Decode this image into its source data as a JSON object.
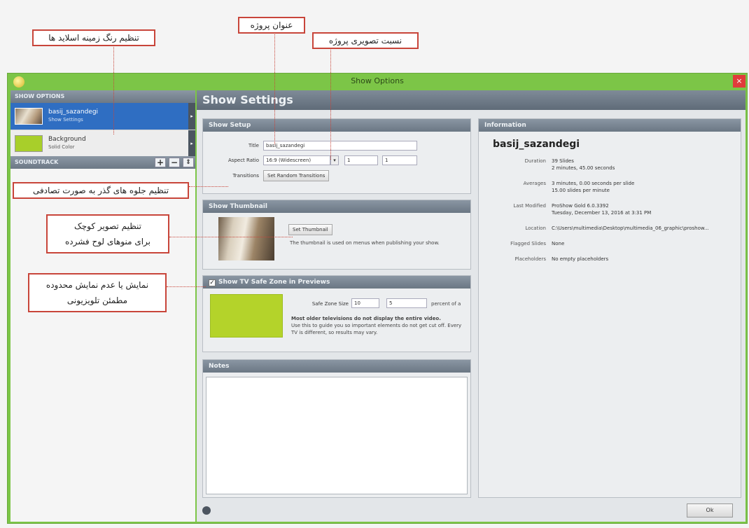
{
  "annotations": {
    "slide_bg_color": "تنظیم رنگ زمینه اسلاید ها",
    "project_title": "عنوان پروژه",
    "project_aspect": "نسبت تصویری پروژه",
    "random_transitions": "تنظیم جلوه های گذر به صورت تصادفی",
    "thumbnail_line1": "تنظیم تصویر کوچک",
    "thumbnail_line2": "برای منوهای لوح فشرده",
    "safe_zone_line1": "نمایش یا عدم نمایش محدوده",
    "safe_zone_line2": "مطمئن تلویزیونی"
  },
  "window": {
    "title": "Show Options",
    "close": "×"
  },
  "left": {
    "show_options_header": "SHOW OPTIONS",
    "items": [
      {
        "name": "basij_sazandegi",
        "sub": "Show Settings",
        "arrow": "▸"
      },
      {
        "name": "Background",
        "sub": "Solid Color",
        "thumb": "color",
        "arrow": "▸"
      }
    ],
    "soundtrack_header": "SOUNDTRACK",
    "buttons": {
      "add": "+",
      "remove": "−",
      "move": "⇕"
    }
  },
  "main": {
    "header": "Show Settings",
    "setup": {
      "header": "Show Setup",
      "title_label": "Title",
      "title_value": "basij_sazandegi",
      "aspect_label": "Aspect Ratio",
      "aspect_value": "16:9 (Widescreen)",
      "aspect_w": "1",
      "aspect_h": "1",
      "transitions_label": "Transitions",
      "transitions_button": "Set Random Transitions"
    },
    "thumbnail": {
      "header": "Show Thumbnail",
      "set_button": "Set Thumbnail",
      "desc": "The thumbnail is used on menus when publishing your show."
    },
    "safe_zone": {
      "header": "Show TV Safe Zone in Previews",
      "checked": true,
      "size_label": "Safe Zone Size",
      "size_w": "10",
      "size_h": "5",
      "percent_label": "percent of a",
      "desc_bold": "Most older televisions do not display the entire video.",
      "desc_rest": "Use this to guide you so important elements do not get cut off. Every TV is different, so results may vary.",
      "swatch_color": "#b4d32a"
    },
    "notes": {
      "header": "Notes"
    },
    "information": {
      "header": "Information",
      "show_name": "basij_sazandegi",
      "rows": [
        {
          "label": "Duration",
          "value": "39 Slides",
          "value2": "2 minutes, 45.00 seconds"
        },
        {
          "label": "Averages",
          "value": "3 minutes, 0.00 seconds per slide",
          "value2": "15.00 slides per minute"
        },
        {
          "label": "Last Modified",
          "value": "ProShow Gold 6.0.3392",
          "value2": "Tuesday, December 13, 2016 at 3:31 PM"
        },
        {
          "label": "Location",
          "value": "C:\\Users\\multimedia\\Desktop\\multimedia_06_graphic\\proshow...",
          "value2": ""
        },
        {
          "label": "Flagged Slides",
          "value": "None",
          "value2": ""
        },
        {
          "label": "Placeholders",
          "value": "No empty placeholders",
          "value2": ""
        }
      ]
    },
    "ok_button": "Ok"
  }
}
